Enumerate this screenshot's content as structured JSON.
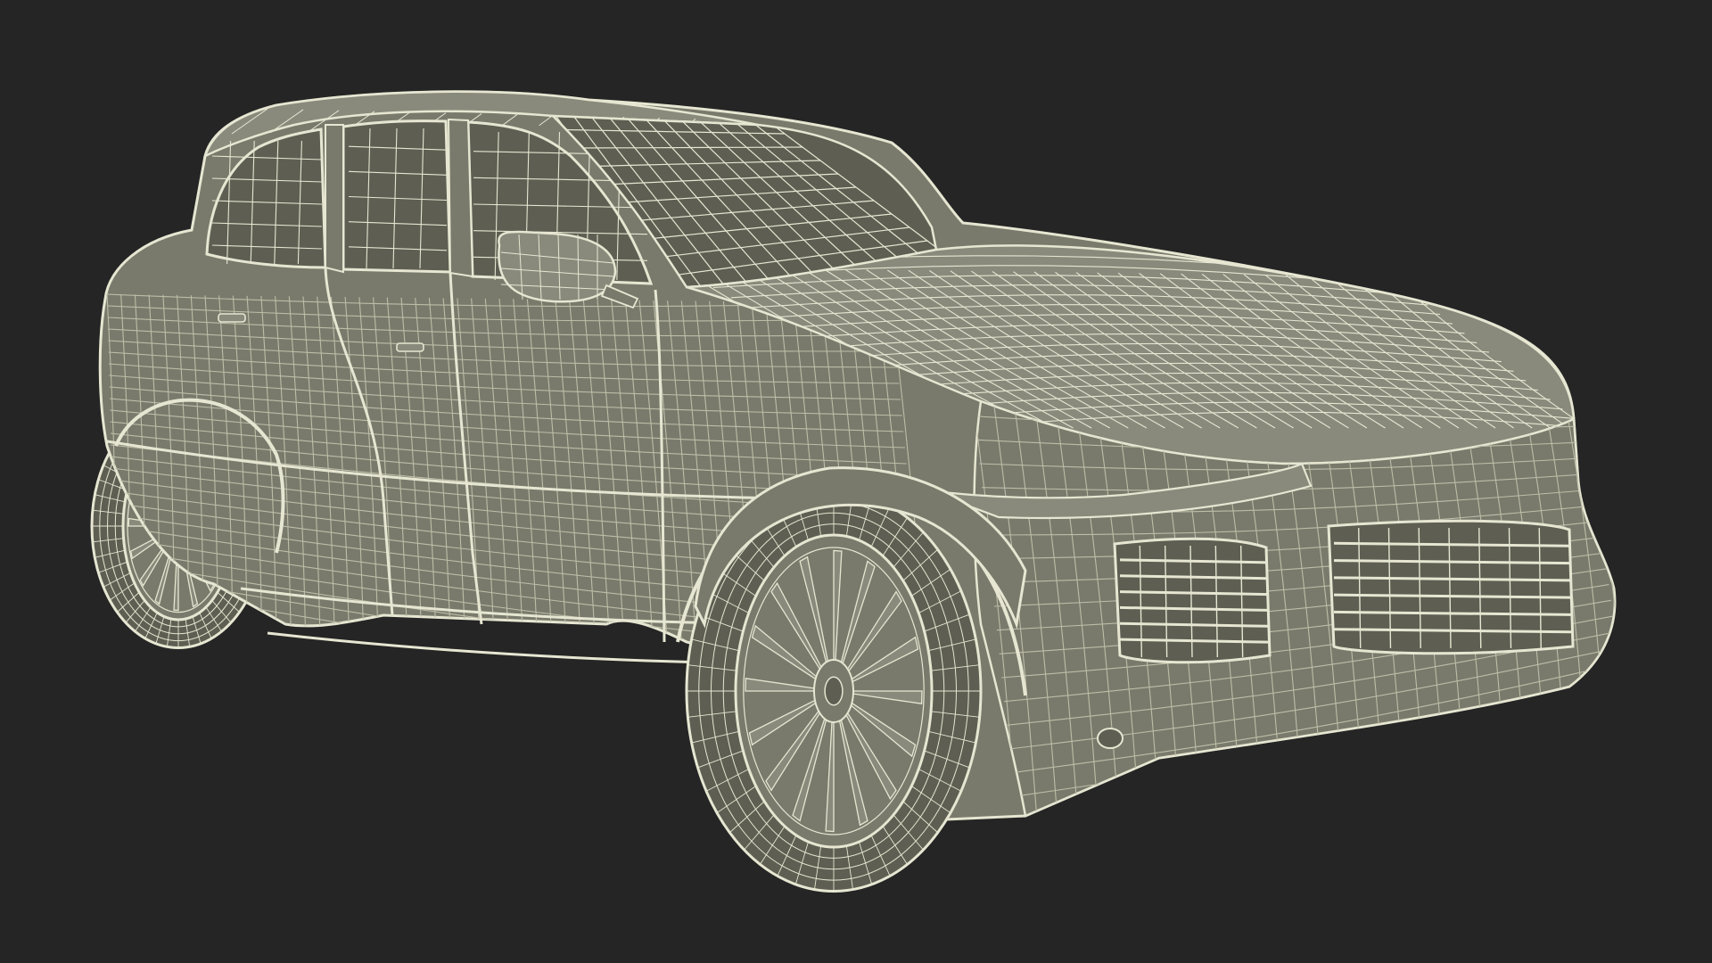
{
  "scene": {
    "subject": "wireframe-suv-render",
    "background_color": "#252525",
    "surface_color": "#7a7a6c",
    "surface_dark_color": "#5e5e52",
    "surface_light_color": "#8a8a7c",
    "wire_color": "#e6e6d2",
    "wire_dim_color": "#bdbda8"
  }
}
